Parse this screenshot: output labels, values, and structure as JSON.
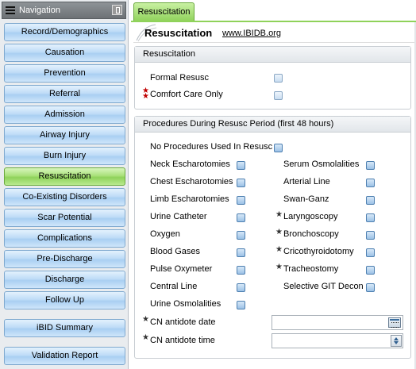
{
  "nav": {
    "title": "Navigation",
    "items": [
      {
        "label": "Record/Demographics"
      },
      {
        "label": "Causation"
      },
      {
        "label": "Prevention"
      },
      {
        "label": "Referral"
      },
      {
        "label": "Admission"
      },
      {
        "label": "Airway Injury"
      },
      {
        "label": "Burn Injury"
      },
      {
        "label": "Resuscitation",
        "active": true
      },
      {
        "label": "Co-Existing Disorders"
      },
      {
        "label": "Scar Potential"
      },
      {
        "label": "Complications"
      },
      {
        "label": "Pre-Discharge"
      },
      {
        "label": "Discharge"
      },
      {
        "label": "Follow Up"
      },
      {
        "label": "iBID Summary"
      },
      {
        "label": "Validation Report"
      }
    ]
  },
  "tab": {
    "label": "Resuscitation"
  },
  "header": {
    "title": "Resuscitation",
    "link": "www.IBIDB.org"
  },
  "resusc_group": {
    "title": "Resuscitation",
    "fields": [
      {
        "label": "Formal Resusc",
        "required": false,
        "checked": false
      },
      {
        "label": "Comfort Care Only",
        "required": true,
        "checked": false
      }
    ]
  },
  "procedures_group": {
    "title": "Procedures During Resusc Period (first 48 hours)",
    "no_procedures": {
      "label": "No Procedures Used In Resusc",
      "checked": false
    },
    "left": [
      {
        "label": "Neck Escharotomies",
        "star": false
      },
      {
        "label": "Chest Escharotomies",
        "star": false
      },
      {
        "label": "Limb Escharotomies",
        "star": false
      },
      {
        "label": "Urine Catheter",
        "star": false
      },
      {
        "label": "Oxygen",
        "star": false
      },
      {
        "label": "Blood Gases",
        "star": false
      },
      {
        "label": "Pulse Oxymeter",
        "star": false
      },
      {
        "label": "Central Line",
        "star": false
      },
      {
        "label": "Urine Osmolalities",
        "star": false
      }
    ],
    "right": [
      {
        "label": "Serum Osmolalities",
        "star": false
      },
      {
        "label": "Arterial Line",
        "star": false
      },
      {
        "label": "Swan-Ganz",
        "star": false
      },
      {
        "label": "Laryngoscopy",
        "star": true
      },
      {
        "label": "Bronchoscopy",
        "star": true
      },
      {
        "label": "Cricothyroidotomy",
        "star": true
      },
      {
        "label": "Tracheostomy",
        "star": true
      },
      {
        "label": "Selective GIT Decon",
        "star": false
      }
    ],
    "cn_date": {
      "label": "CN antidote date",
      "value": "",
      "icon": "calendar-icon"
    },
    "cn_time": {
      "label": "CN antidote time",
      "value": "",
      "icon": "spinner-icon"
    }
  },
  "colors": {
    "active_green": "#8fd25a",
    "nav_blue": "#bfdcf7",
    "required_red": "#c00000"
  }
}
